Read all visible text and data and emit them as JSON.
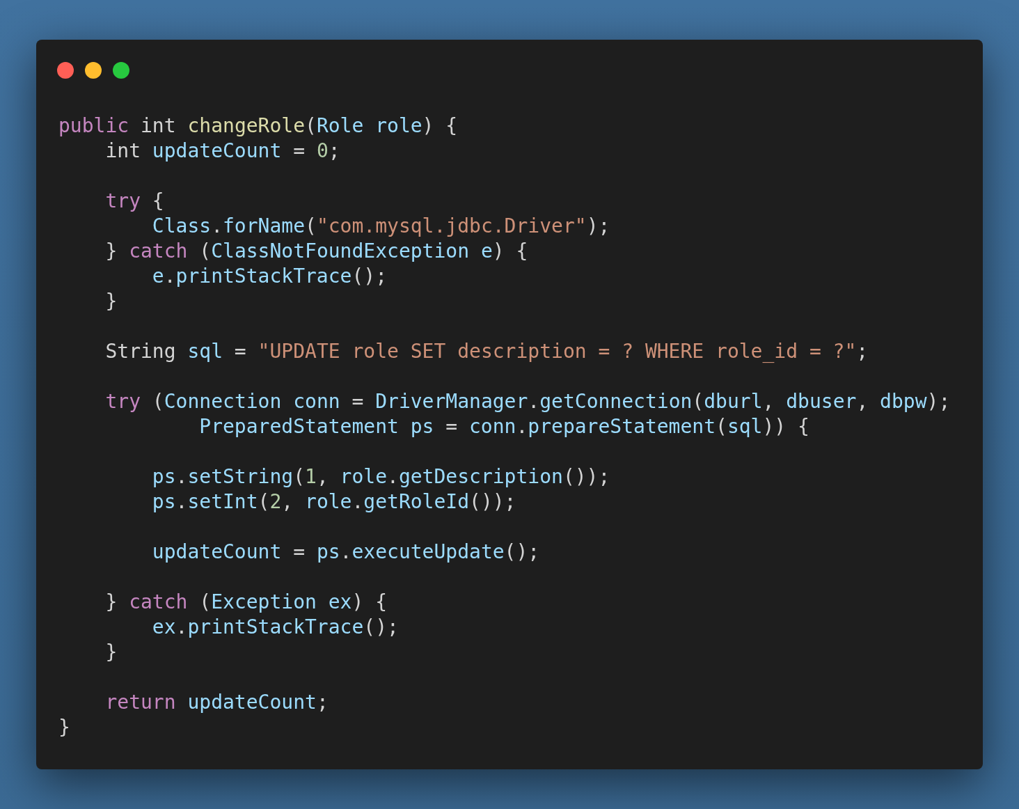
{
  "code": {
    "blocks": [
      {
        "lines": [
          [
            {
              "kind": "keyword",
              "text": "public"
            },
            {
              "kind": "plain",
              "text": " int "
            },
            {
              "kind": "function",
              "text": "changeRole"
            },
            {
              "kind": "plain",
              "text": "("
            },
            {
              "kind": "variable",
              "text": "Role role"
            },
            {
              "kind": "plain",
              "text": ") {"
            }
          ],
          [
            {
              "kind": "plain",
              "text": "    int "
            },
            {
              "kind": "variable",
              "text": "updateCount"
            },
            {
              "kind": "plain",
              "text": " = "
            },
            {
              "kind": "number",
              "text": "0"
            },
            {
              "kind": "plain",
              "text": ";"
            }
          ]
        ]
      },
      {
        "lines": [
          [
            {
              "kind": "keyword",
              "text": "    try"
            },
            {
              "kind": "plain",
              "text": " {"
            }
          ],
          [
            {
              "kind": "variable",
              "text": "        Class"
            },
            {
              "kind": "plain",
              "text": "."
            },
            {
              "kind": "variable",
              "text": "forName"
            },
            {
              "kind": "plain",
              "text": "("
            },
            {
              "kind": "string",
              "text": "\"com.mysql.jdbc.Driver\""
            },
            {
              "kind": "plain",
              "text": ");"
            }
          ],
          [
            {
              "kind": "plain",
              "text": "    } "
            },
            {
              "kind": "keyword",
              "text": "catch"
            },
            {
              "kind": "plain",
              "text": " ("
            },
            {
              "kind": "variable",
              "text": "ClassNotFoundException e"
            },
            {
              "kind": "plain",
              "text": ") {"
            }
          ],
          [
            {
              "kind": "variable",
              "text": "        e"
            },
            {
              "kind": "plain",
              "text": "."
            },
            {
              "kind": "variable",
              "text": "printStackTrace"
            },
            {
              "kind": "plain",
              "text": "();"
            }
          ],
          [
            {
              "kind": "plain",
              "text": "    }"
            }
          ]
        ]
      },
      {
        "lines": [
          [
            {
              "kind": "plain",
              "text": "    String "
            },
            {
              "kind": "variable",
              "text": "sql"
            },
            {
              "kind": "plain",
              "text": " = "
            },
            {
              "kind": "string",
              "text": "\"UPDATE role SET description = ? WHERE role_id = ?\""
            },
            {
              "kind": "plain",
              "text": ";"
            }
          ]
        ]
      },
      {
        "lines": [
          [
            {
              "kind": "keyword",
              "text": "    try"
            },
            {
              "kind": "plain",
              "text": " ("
            },
            {
              "kind": "variable",
              "text": "Connection conn"
            },
            {
              "kind": "plain",
              "text": " = "
            },
            {
              "kind": "variable",
              "text": "DriverManager"
            },
            {
              "kind": "plain",
              "text": "."
            },
            {
              "kind": "variable",
              "text": "getConnection"
            },
            {
              "kind": "plain",
              "text": "("
            },
            {
              "kind": "variable",
              "text": "dburl"
            },
            {
              "kind": "plain",
              "text": ", "
            },
            {
              "kind": "variable",
              "text": "dbuser"
            },
            {
              "kind": "plain",
              "text": ", "
            },
            {
              "kind": "variable",
              "text": "dbpw"
            },
            {
              "kind": "plain",
              "text": ");"
            }
          ],
          [
            {
              "kind": "variable",
              "text": "            PreparedStatement ps"
            },
            {
              "kind": "plain",
              "text": " = "
            },
            {
              "kind": "variable",
              "text": "conn"
            },
            {
              "kind": "plain",
              "text": "."
            },
            {
              "kind": "variable",
              "text": "prepareStatement"
            },
            {
              "kind": "plain",
              "text": "("
            },
            {
              "kind": "variable",
              "text": "sql"
            },
            {
              "kind": "plain",
              "text": ")) {"
            }
          ]
        ]
      },
      {
        "lines": [
          [
            {
              "kind": "variable",
              "text": "        ps"
            },
            {
              "kind": "plain",
              "text": "."
            },
            {
              "kind": "variable",
              "text": "setString"
            },
            {
              "kind": "plain",
              "text": "("
            },
            {
              "kind": "number",
              "text": "1"
            },
            {
              "kind": "plain",
              "text": ", "
            },
            {
              "kind": "variable",
              "text": "role"
            },
            {
              "kind": "plain",
              "text": "."
            },
            {
              "kind": "variable",
              "text": "getDescription"
            },
            {
              "kind": "plain",
              "text": "());"
            }
          ],
          [
            {
              "kind": "variable",
              "text": "        ps"
            },
            {
              "kind": "plain",
              "text": "."
            },
            {
              "kind": "variable",
              "text": "setInt"
            },
            {
              "kind": "plain",
              "text": "("
            },
            {
              "kind": "number",
              "text": "2"
            },
            {
              "kind": "plain",
              "text": ", "
            },
            {
              "kind": "variable",
              "text": "role"
            },
            {
              "kind": "plain",
              "text": "."
            },
            {
              "kind": "variable",
              "text": "getRoleId"
            },
            {
              "kind": "plain",
              "text": "());"
            }
          ]
        ]
      },
      {
        "lines": [
          [
            {
              "kind": "variable",
              "text": "        updateCount"
            },
            {
              "kind": "plain",
              "text": " = "
            },
            {
              "kind": "variable",
              "text": "ps"
            },
            {
              "kind": "plain",
              "text": "."
            },
            {
              "kind": "variable",
              "text": "executeUpdate"
            },
            {
              "kind": "plain",
              "text": "();"
            }
          ]
        ]
      },
      {
        "lines": [
          [
            {
              "kind": "plain",
              "text": "    } "
            },
            {
              "kind": "keyword",
              "text": "catch"
            },
            {
              "kind": "plain",
              "text": " ("
            },
            {
              "kind": "variable",
              "text": "Exception ex"
            },
            {
              "kind": "plain",
              "text": ") {"
            }
          ],
          [
            {
              "kind": "variable",
              "text": "        ex"
            },
            {
              "kind": "plain",
              "text": "."
            },
            {
              "kind": "variable",
              "text": "printStackTrace"
            },
            {
              "kind": "plain",
              "text": "();"
            }
          ],
          [
            {
              "kind": "plain",
              "text": "    }"
            }
          ]
        ]
      },
      {
        "lines": [
          [
            {
              "kind": "keyword",
              "text": "    return"
            },
            {
              "kind": "variable",
              "text": " updateCount"
            },
            {
              "kind": "plain",
              "text": ";"
            }
          ],
          [
            {
              "kind": "plain",
              "text": "}"
            }
          ]
        ]
      }
    ]
  }
}
